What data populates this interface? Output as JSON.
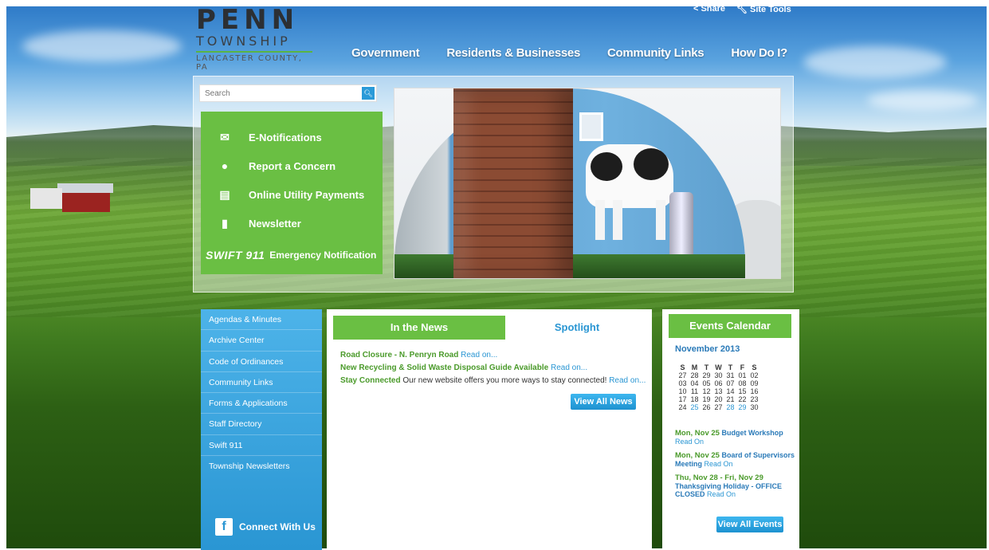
{
  "header": {
    "logo_main": "PENN",
    "logo_sub": "TOWNSHIP",
    "logo_county": "LANCASTER COUNTY, PA",
    "utility": [
      {
        "icon": "share-icon",
        "label": "Share"
      },
      {
        "icon": "wrench-icon",
        "label": "Site Tools"
      }
    ],
    "nav": [
      "Government",
      "Residents & Businesses",
      "Community Links",
      "How Do I?"
    ]
  },
  "search": {
    "placeholder": "Search"
  },
  "quick_links": [
    {
      "icon": "envelope-icon",
      "label": "E-Notifications"
    },
    {
      "icon": "speech-bubble-icon",
      "label": "Report a Concern"
    },
    {
      "icon": "credit-card-icon",
      "label": "Online Utility Payments"
    },
    {
      "icon": "document-icon",
      "label": "Newsletter"
    }
  ],
  "swift911": {
    "logo": "SWIFT 911",
    "label": "Emergency Notification"
  },
  "sidebar": {
    "items": [
      "Agendas & Minutes",
      "Archive Center",
      "Code of Ordinances",
      "Community Links",
      "Forms & Applications",
      "Staff Directory",
      "Swift 911",
      "Township Newsletters"
    ],
    "connect": "Connect With Us"
  },
  "news": {
    "tab_news": "In the News",
    "tab_spotlight": "Spotlight",
    "items": [
      {
        "title": "Road Closure - N. Penryn Road",
        "text": "",
        "more": "Read on..."
      },
      {
        "title": "New Recycling & Solid Waste Disposal Guide Available",
        "text": "",
        "more": "Read on..."
      },
      {
        "title": "Stay Connected",
        "text": "Our new website offers you more ways to stay connected!",
        "more": "Read on..."
      }
    ],
    "view_all": "View All News"
  },
  "events": {
    "title": "Events Calendar",
    "month": "November 2013",
    "days": [
      "S",
      "M",
      "T",
      "W",
      "T",
      "F",
      "S"
    ],
    "weeks": [
      [
        "27",
        "28",
        "29",
        "30",
        "31",
        "01",
        "02"
      ],
      [
        "03",
        "04",
        "05",
        "06",
        "07",
        "08",
        "09"
      ],
      [
        "10",
        "11",
        "12",
        "13",
        "14",
        "15",
        "16"
      ],
      [
        "17",
        "18",
        "19",
        "20",
        "21",
        "22",
        "23"
      ],
      [
        "24",
        "25",
        "26",
        "27",
        "28",
        "29",
        "30"
      ]
    ],
    "highlighted": [
      "25",
      "28",
      "29"
    ],
    "items": [
      {
        "date": "Mon, Nov 25",
        "title": "Budget Workshop",
        "more": "Read On"
      },
      {
        "date": "Mon, Nov 25",
        "title": "Board of Supervisors Meeting",
        "more": "Read On"
      },
      {
        "date": "Thu, Nov 28 - Fri, Nov 29",
        "title": "Thanksgiving Holiday - OFFICE CLOSED",
        "more": "Read On"
      }
    ],
    "view_all": "View All Events"
  }
}
